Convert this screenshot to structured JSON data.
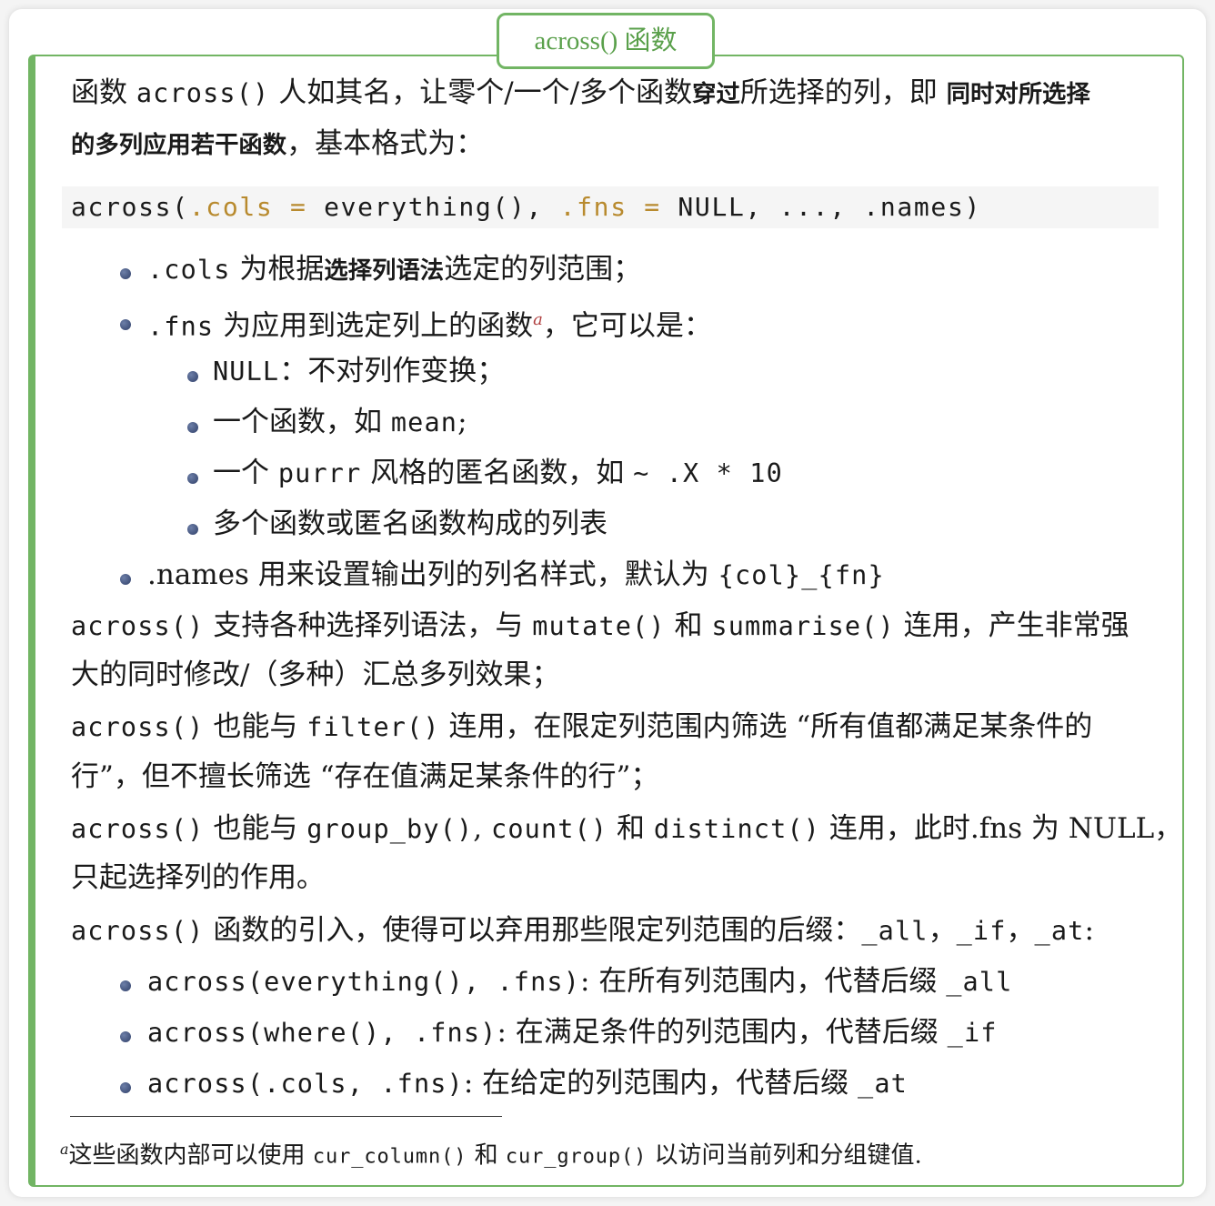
{
  "title": "across() 函数",
  "intro": {
    "t1": "函数 ",
    "c1": "across()",
    "t2": " 人如其名，让零个/一个/多个函数",
    "b1": "穿过",
    "t3": "所选择的列，即 ",
    "b2": "同时对所选择",
    "b3": "的多列应用若干函数",
    "t4": "，基本格式为："
  },
  "code": {
    "p1": "across(",
    "a1": ".cols = ",
    "p2": "everything(), ",
    "a2": ".fns = ",
    "p3": "NULL, ..., .names)"
  },
  "items": {
    "cols": {
      "code": ".cols",
      "t1": " 为根据",
      "b1": "选择列语法",
      "t2": "选定的列范围；"
    },
    "fns": {
      "code": ".fns",
      "t1": " 为应用到选定列上的函数",
      "sup": "a",
      "t2": "，它可以是："
    },
    "sub1": {
      "code": "NULL",
      "t1": "：不对列作变换；"
    },
    "sub2": {
      "t1": "一个函数，如 ",
      "code": "mean",
      "t2": ";"
    },
    "sub3": {
      "t1": "一个 ",
      "code": "purrr",
      "t2": " 风格的匿名函数，如 ",
      "code2": "~ .X * 10"
    },
    "sub4": {
      "t1": "多个函数或匿名函数构成的列表"
    },
    "names": {
      "t1": ".names 用来设置输出列的列名样式，默认为 ",
      "code": "{col}_{fn}"
    }
  },
  "para1": {
    "c1": "across()",
    "t1": " 支持各种选择列语法，与 ",
    "c2": "mutate()",
    "t2": " 和 ",
    "c3": "summarise()",
    "t3": " 连用，产生非常强",
    "line2": "大的同时修改/（多种）汇总多列效果；"
  },
  "para2": {
    "c1": "across()",
    "t1": " 也能与 ",
    "c2": "filter()",
    "t2": " 连用，在限定列范围内筛选 “所有值都满足某条件的",
    "line2": "行”，但不擅长筛选 “存在值满足某条件的行”；"
  },
  "para3": {
    "c1": "across()",
    "t1": " 也能与 ",
    "c2": "group_by()",
    "t2": ", ",
    "c3": "count()",
    "t3": " 和 ",
    "c4": "distinct()",
    "t4": " 连用，此时.fns 为 NULL，",
    "line2": "只起选择列的作用。"
  },
  "para4": {
    "c1": "across()",
    "t1": " 函数的引入，使得可以弃用那些限定列范围的后缀：",
    "c2": "_all",
    "t2": "，",
    "c3": "_if",
    "t3": "，",
    "c4": "_at",
    "t4": ":"
  },
  "suffix": [
    {
      "code": "across(everything(), .fns)",
      "text": ": 在所有列范围内，代替后缀 ",
      "suffix": "_all"
    },
    {
      "code": "across(where(), .fns)",
      "text": ": 在满足条件的列范围内，代替后缀 ",
      "suffix": "_if"
    },
    {
      "code": "across(.cols, .fns)",
      "text": ": 在给定的列范围内，代替后缀 ",
      "suffix": "_at"
    }
  ],
  "footnote": {
    "mark": "a",
    "t1": "这些函数内部可以使用 ",
    "c1": "cur_column()",
    "t2": " 和 ",
    "c2": "cur_group()",
    "t3": " 以访问当前列和分组键值."
  }
}
